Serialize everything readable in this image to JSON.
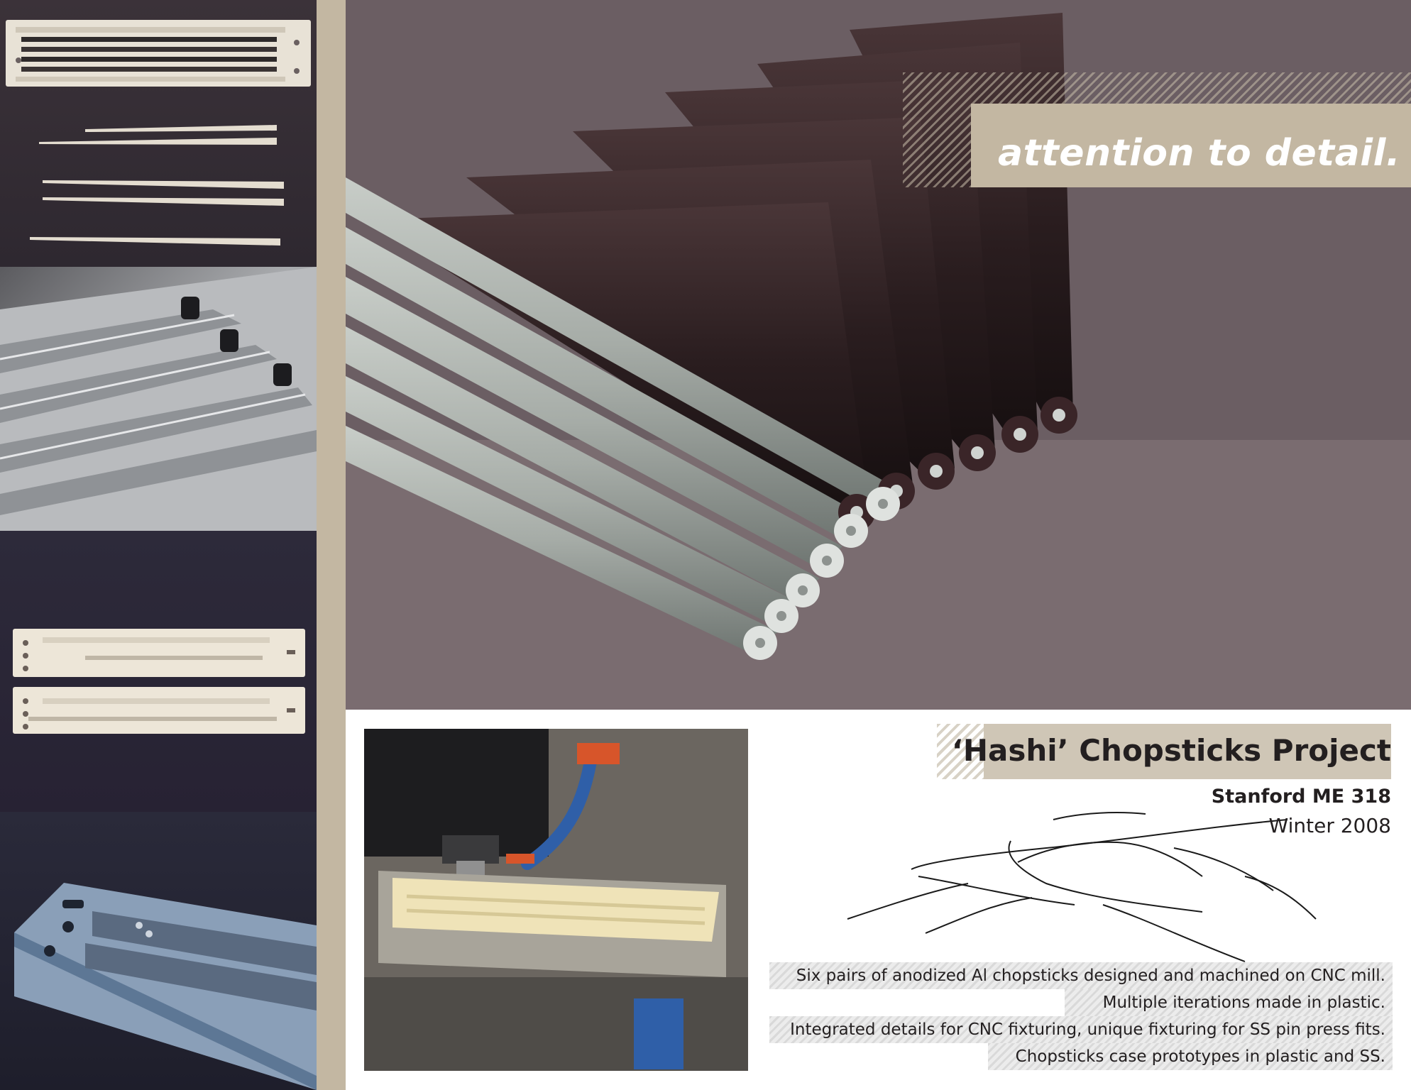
{
  "tagline": "attention to detail.",
  "project": {
    "title": "‘Hashi’ Chopsticks Project",
    "course": "Stanford ME 318",
    "term": "Winter 2008"
  },
  "description": [
    "Six pairs of anodized Al chopsticks designed and machined on CNC mill.",
    "Multiple iterations made in plastic.",
    "Integrated details for CNC fixturing, unique fixturing for SS pin press fits.",
    "Chopsticks case prototypes in plastic and SS."
  ],
  "colors": {
    "accent_tan": "#c3b7a2",
    "text_dark": "#231f20",
    "photo_dark": "#2b2531"
  }
}
